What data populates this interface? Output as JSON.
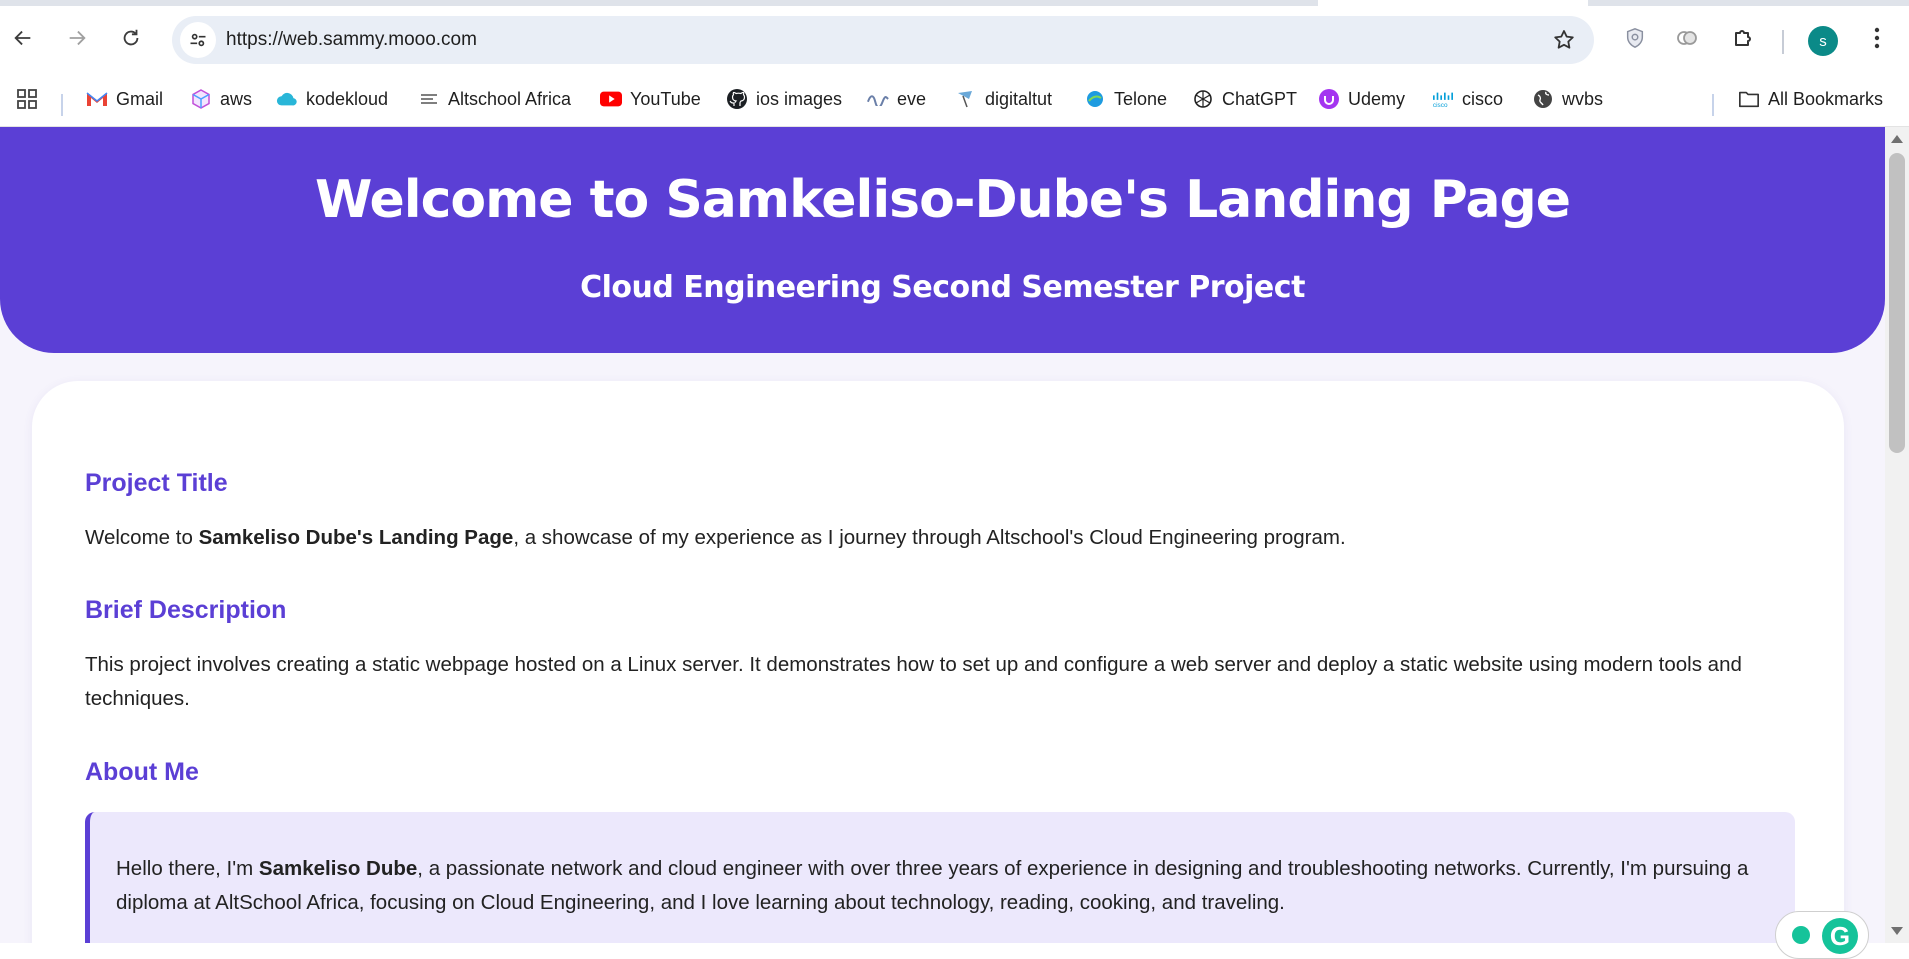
{
  "browser": {
    "url": "https://web.sammy.mooo.com",
    "avatar_letter": "s",
    "colors": {
      "avatar": "#0b8a88",
      "omnibox": "#e9eef6"
    }
  },
  "bookmarks": {
    "items": [
      {
        "label": "Gmail",
        "icon": "gmail-icon"
      },
      {
        "label": "aws",
        "icon": "aws-cube-icon"
      },
      {
        "label": "kodekloud",
        "icon": "kodekloud-icon"
      },
      {
        "label": "Altschool Africa",
        "icon": "altschool-icon"
      },
      {
        "label": "YouTube",
        "icon": "youtube-icon"
      },
      {
        "label": "ios images",
        "icon": "github-icon"
      },
      {
        "label": "eve",
        "icon": "eve-icon"
      },
      {
        "label": "digitaltut",
        "icon": "digitaltut-icon"
      },
      {
        "label": "Telone",
        "icon": "telone-icon"
      },
      {
        "label": "ChatGPT",
        "icon": "chatgpt-icon"
      },
      {
        "label": "Udemy",
        "icon": "udemy-icon"
      },
      {
        "label": "cisco",
        "icon": "cisco-icon"
      },
      {
        "label": "wvbs",
        "icon": "globe-icon"
      }
    ],
    "all_bookmarks": "All Bookmarks"
  },
  "page": {
    "hero_title": "Welcome to Samkeliso-Dube's Landing Page",
    "hero_subtitle": "Cloud Engineering Second Semester Project",
    "colors": {
      "accent": "#5b3fd5",
      "background": "#f6f4fc",
      "about_box": "#ece8fc"
    },
    "sections": {
      "project": {
        "title": "Project Title",
        "text_before": "Welcome to ",
        "text_bold": "Samkeliso Dube's Landing Page",
        "text_after": ", a showcase of my experience as I journey through Altschool's Cloud Engineering program."
      },
      "description": {
        "title": "Brief Description",
        "text": "This project involves creating a static webpage hosted on a Linux server. It demonstrates how to set up and configure a web server and deploy a static website using modern tools and techniques."
      },
      "about": {
        "title": "About Me",
        "text_before": "Hello there, I'm ",
        "text_bold": "Samkeliso Dube",
        "text_after": ", a passionate network and cloud engineer with over three years of experience in designing and troubleshooting networks. Currently, I'm pursuing a diploma at AltSchool Africa, focusing on Cloud Engineering, and I love learning about technology, reading, cooking, and traveling."
      }
    }
  }
}
